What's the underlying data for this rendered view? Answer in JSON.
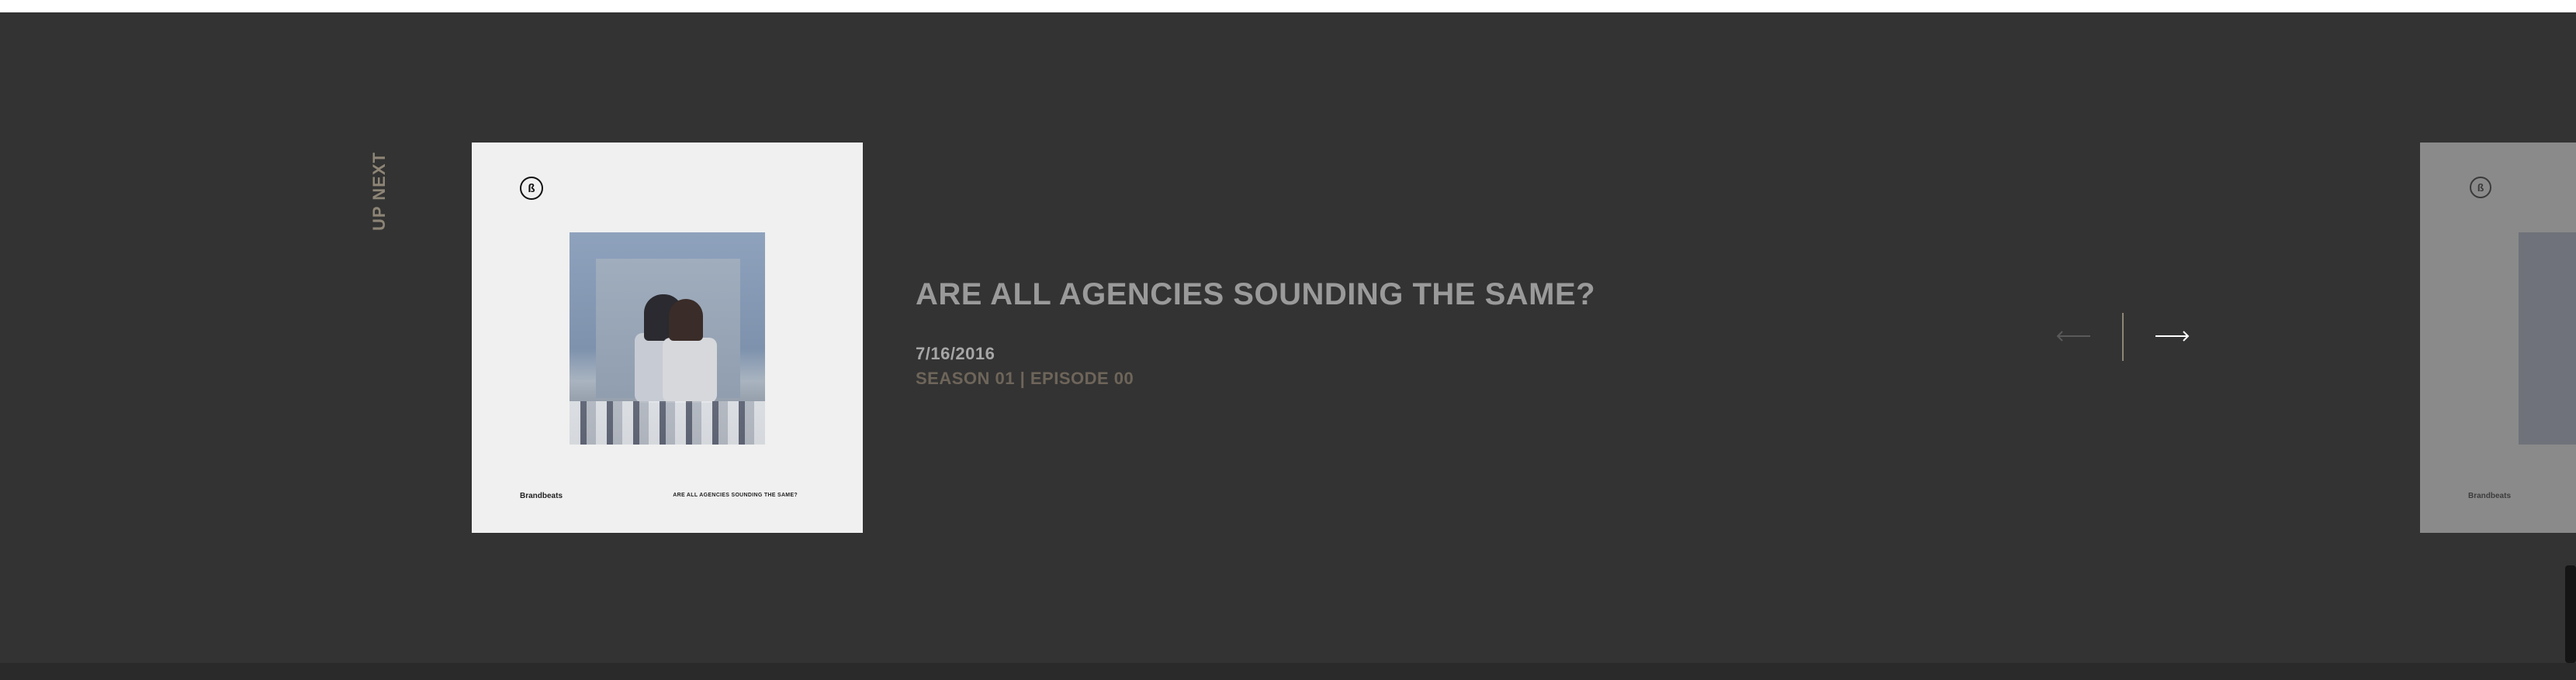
{
  "section": {
    "label": "UP NEXT"
  },
  "current_card": {
    "logo_glyph": "ß",
    "brand": "Brandbeats",
    "title": "ARE ALL AGENCIES SOUNDING THE SAME?"
  },
  "episode": {
    "title": "ARE ALL AGENCIES SOUNDING THE SAME?",
    "date": "7/16/2016",
    "season": "SEASON 01 | EPISODE 00"
  },
  "next_card": {
    "logo_glyph": "ß",
    "brand": "Brandbeats"
  },
  "colors": {
    "background": "#333333",
    "accent_muted": "#8e8576",
    "season_text": "#6e655a"
  }
}
